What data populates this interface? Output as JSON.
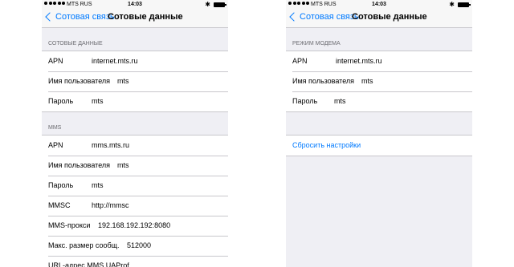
{
  "left": {
    "status": {
      "carrier": "MTS RUS",
      "time": "14:03",
      "bluetooth": "✱"
    },
    "nav": {
      "back_label": "Сотовая связь",
      "title": "Сотовые данные"
    },
    "sections": [
      {
        "header": "СОТОВЫЕ ДАННЫЕ",
        "rows": [
          {
            "label": "APN",
            "value": "internet.mts.ru"
          },
          {
            "label": "Имя пользователя",
            "value": "mts"
          },
          {
            "label": "Пароль",
            "value": "mts"
          }
        ]
      },
      {
        "header": "MMS",
        "rows": [
          {
            "label": "APN",
            "value": "mms.mts.ru"
          },
          {
            "label": "Имя пользователя",
            "value": "mts"
          },
          {
            "label": "Пароль",
            "value": "mts"
          },
          {
            "label": "MMSC",
            "value": "http://mmsc"
          },
          {
            "label": "MMS-прокси",
            "value": "192.168.192.192:8080"
          },
          {
            "label": "Макс. размер сообщ.",
            "value": "512000"
          },
          {
            "label": "URL-адрес MMS UAProf",
            "value": ""
          }
        ]
      }
    ]
  },
  "right": {
    "status": {
      "carrier": "MTS RUS",
      "time": "14:03",
      "bluetooth": "✱"
    },
    "nav": {
      "back_label": "Сотовая связь",
      "title": "Сотовые данные"
    },
    "sections": [
      {
        "header": "РЕЖИМ МОДЕМА",
        "rows": [
          {
            "label": "APN",
            "value": "internet.mts.ru"
          },
          {
            "label": "Имя пользователя",
            "value": "mts"
          },
          {
            "label": "Пароль",
            "value": "mts"
          }
        ]
      }
    ],
    "reset_label": "Сбросить настройки"
  },
  "colors": {
    "accent": "#007aff",
    "background": "#efeff4",
    "separator": "#c8c7cc"
  }
}
